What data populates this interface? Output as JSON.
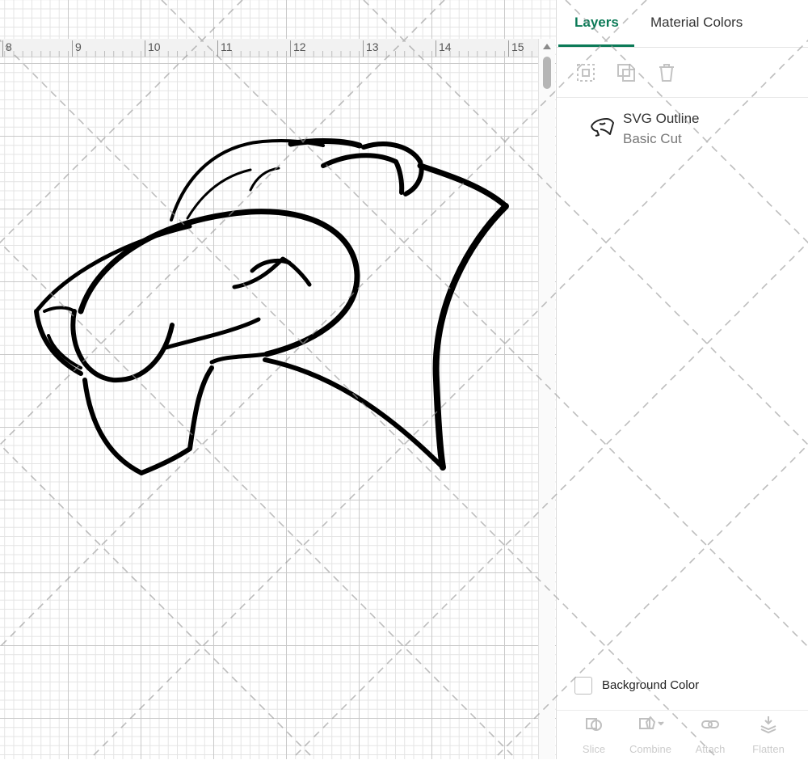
{
  "ruler": {
    "labels": [
      "8",
      "9",
      "10",
      "11",
      "12",
      "13",
      "14",
      "15"
    ]
  },
  "panel": {
    "tabs": [
      {
        "label": "Layers",
        "active": true
      },
      {
        "label": "Material Colors",
        "active": false
      }
    ],
    "toolbar": [
      {
        "icon": "group-icon",
        "enabled": false
      },
      {
        "icon": "duplicate-icon",
        "enabled": false
      },
      {
        "icon": "trash-icon",
        "enabled": false
      }
    ],
    "layer": {
      "title": "SVG Outline",
      "subtitle": "Basic Cut",
      "thumbnail_icon": "panther-head-icon"
    },
    "background": {
      "label": "Background Color",
      "checked": false
    },
    "bottom_actions": [
      {
        "label": "Slice",
        "icon": "slice-icon",
        "enabled": false
      },
      {
        "label": "Combine",
        "icon": "combine-icon",
        "enabled": false
      },
      {
        "label": "Attach",
        "icon": "attach-icon",
        "enabled": false
      },
      {
        "label": "Flatten",
        "icon": "flatten-icon",
        "enabled": false
      }
    ]
  },
  "colors": {
    "accent": "#0b7a57",
    "artwork_stroke": "#000000"
  }
}
